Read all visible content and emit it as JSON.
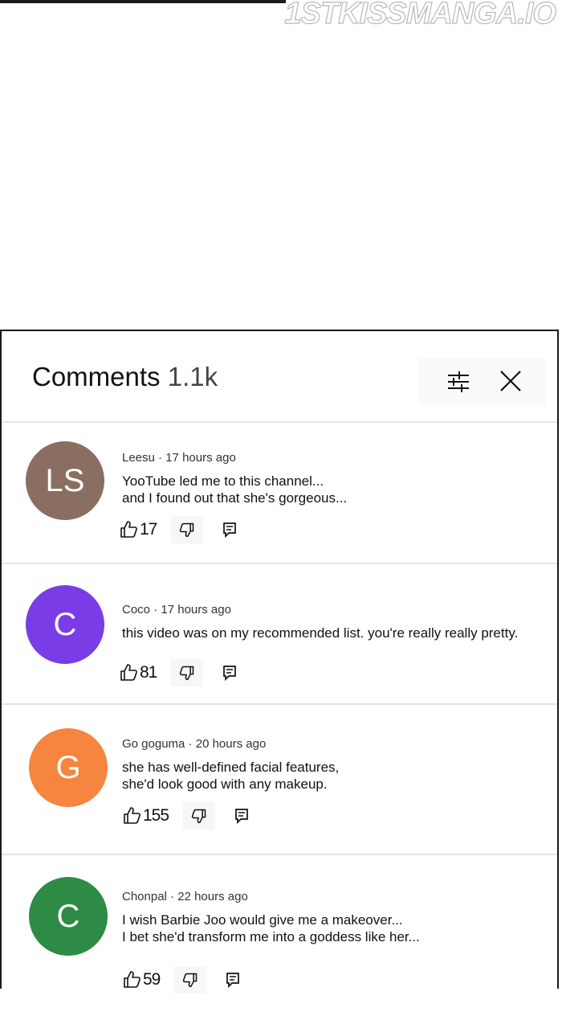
{
  "watermark": "1STKISSMANGA.IO",
  "panel": {
    "title": "Comments",
    "count": "1.1k"
  },
  "comments": [
    {
      "initials": "LS",
      "avatar_color": "#8a6e62",
      "author": "Leesu",
      "time": "17 hours ago",
      "lines": [
        "YooTube led me to this channel...",
        "and I found out that she's gorgeous..."
      ],
      "likes": "17"
    },
    {
      "initials": "C",
      "avatar_color": "#7a3ce6",
      "author": "Coco",
      "time": "17 hours ago",
      "lines": [
        "this video was on my recommended list. you're really really pretty."
      ],
      "likes": "81"
    },
    {
      "initials": "G",
      "avatar_color": "#f5853f",
      "author": "Go goguma",
      "time": "20 hours ago",
      "lines": [
        "she has well-defined facial features,",
        "she'd look good with any makeup."
      ],
      "likes": "155"
    },
    {
      "initials": "C",
      "avatar_color": "#2e8b45",
      "author": "Chonpal",
      "time": "22 hours ago",
      "lines": [
        "I wish Barbie Joo would give me a makeover...",
        "I bet she'd transform me into a goddess like her..."
      ],
      "likes": "59"
    }
  ]
}
